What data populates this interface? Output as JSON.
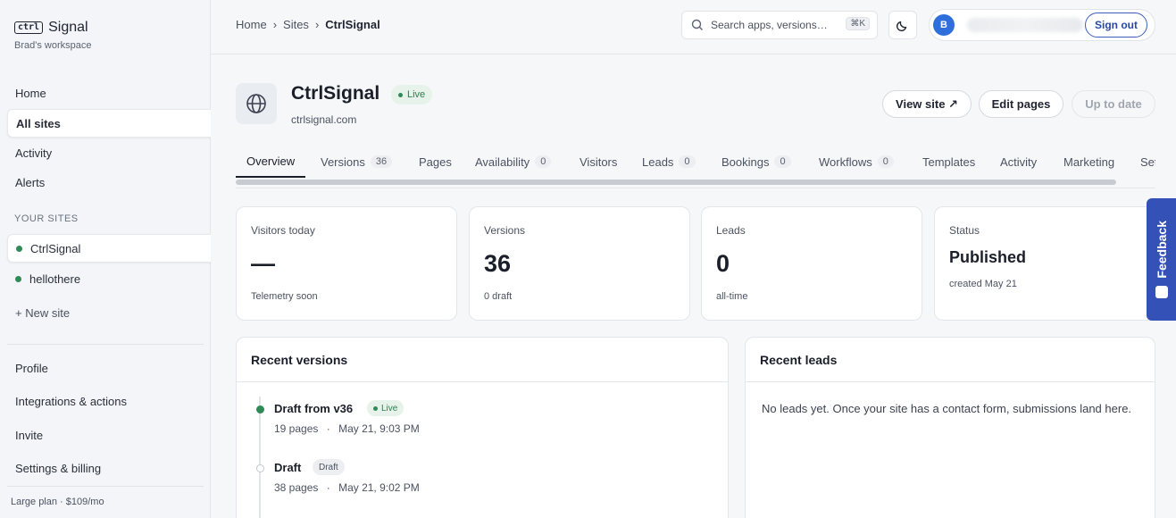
{
  "brand": {
    "box": "ctrl",
    "name": "Signal",
    "workspace": "Brad's workspace"
  },
  "sidebar": {
    "nav": [
      {
        "label": "Home"
      },
      {
        "label": "All sites"
      },
      {
        "label": "Activity"
      },
      {
        "label": "Alerts"
      }
    ],
    "section_label": "YOUR SITES",
    "sites": [
      {
        "label": "CtrlSignal"
      },
      {
        "label": "hellothere"
      }
    ],
    "new_site": "+ New site",
    "account": [
      {
        "label": "Profile"
      },
      {
        "label": "Integrations & actions"
      },
      {
        "label": "Invite"
      },
      {
        "label": "Settings & billing"
      }
    ],
    "plan": "Large plan · $109/mo"
  },
  "topbar": {
    "crumbs": [
      "Home",
      "Sites",
      "CtrlSignal"
    ],
    "search_placeholder": "Search apps, versions…",
    "shortcut": "⌘K",
    "avatar_initial": "B",
    "sign_out": "Sign out"
  },
  "site": {
    "title": "CtrlSignal",
    "status": "Live",
    "url": "ctrlsignal.com",
    "view_site": "View site ↗",
    "edit_pages": "Edit pages",
    "up_to_date": "Up to date"
  },
  "tabs": [
    {
      "label": "Overview",
      "count": ""
    },
    {
      "label": "Versions",
      "count": "36"
    },
    {
      "label": "Pages",
      "count": ""
    },
    {
      "label": "Availability",
      "count": "0"
    },
    {
      "label": "Visitors",
      "count": ""
    },
    {
      "label": "Leads",
      "count": "0"
    },
    {
      "label": "Bookings",
      "count": "0"
    },
    {
      "label": "Workflows",
      "count": "0"
    },
    {
      "label": "Templates",
      "count": ""
    },
    {
      "label": "Activity",
      "count": ""
    },
    {
      "label": "Marketing",
      "count": ""
    },
    {
      "label": "Settings",
      "count": ""
    }
  ],
  "stats": [
    {
      "label": "Visitors today",
      "value": "—",
      "sub": "Telemetry soon"
    },
    {
      "label": "Versions",
      "value": "36",
      "sub": "0 draft"
    },
    {
      "label": "Leads",
      "value": "0",
      "sub": "all-time"
    },
    {
      "label": "Status",
      "value": "Published",
      "sub": "created May 21"
    }
  ],
  "recent_versions": {
    "title": "Recent versions",
    "items": [
      {
        "title": "Draft from v36",
        "badge": "Live",
        "pages": "19 pages",
        "sep": "·",
        "time": "May 21, 9:03 PM"
      },
      {
        "title": "Draft",
        "badge": "Draft",
        "pages": "38 pages",
        "sep": "·",
        "time": "May 21, 9:02 PM"
      }
    ]
  },
  "recent_leads": {
    "title": "Recent leads",
    "empty": "No leads yet. Once your site has a contact form, submissions land here."
  },
  "feedback": {
    "label": "Feedback"
  },
  "colors": {
    "accent": "#3451b8",
    "live_green": "#2e8b57",
    "avatar": "#2f6fdb"
  }
}
